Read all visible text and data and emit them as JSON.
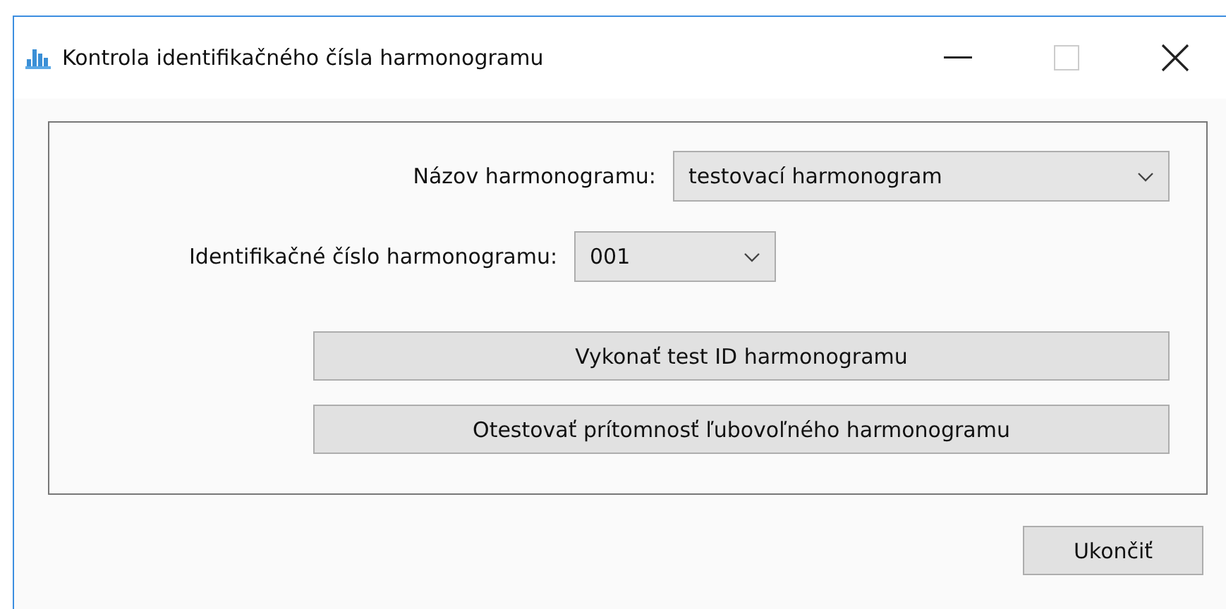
{
  "window": {
    "title": "Kontrola identifikačného čísla harmonogramu"
  },
  "fields": [
    {
      "label": "Názov harmonogramu:",
      "value": "testovací harmonogram",
      "kind": "wide"
    },
    {
      "label": "Identifikačné číslo harmonogramu:",
      "value": "001",
      "kind": "narrow"
    }
  ],
  "actions": [
    "Vykonať test ID harmonogramu",
    "Otestovať prítomnosť ľubovoľného harmonogramu"
  ],
  "close_button": "Ukončiť"
}
